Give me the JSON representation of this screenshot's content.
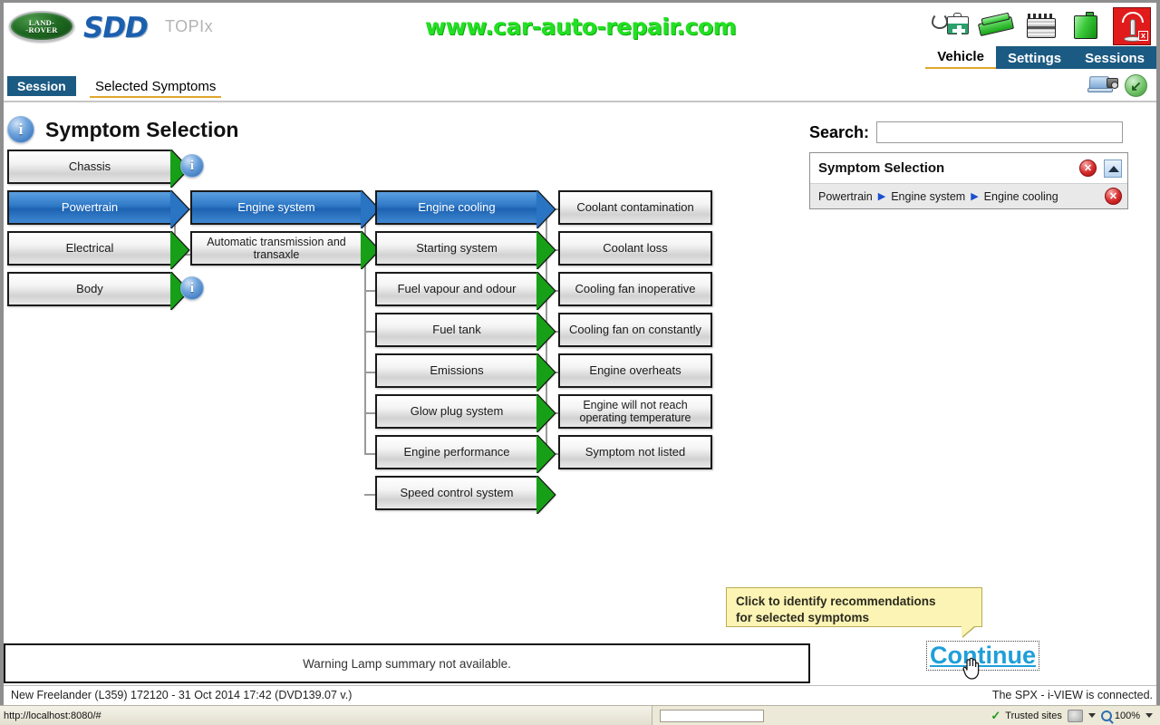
{
  "header": {
    "logo_line1": "LAND-",
    "logo_line2": "-ROVER",
    "product": "SDD",
    "topix": "TOPIx",
    "promo_url": "www.car-auto-repair.com",
    "icons": [
      {
        "name": "medical-kit-icon",
        "label": "Vehicle health"
      },
      {
        "name": "cable-icon",
        "label": "Connector"
      },
      {
        "name": "battery-icon",
        "label": "Battery"
      },
      {
        "name": "fluid-container-icon",
        "label": "Fluids"
      },
      {
        "name": "antenna-disconnected-icon",
        "label": "Network"
      }
    ],
    "nav_tabs": [
      {
        "label": "Vehicle",
        "active": true
      },
      {
        "label": "Settings",
        "active": false
      },
      {
        "label": "Sessions",
        "active": false
      }
    ]
  },
  "subbar": {
    "session_tab": "Session",
    "selected_symptoms_tab": "Selected Symptoms",
    "screenshot_icon": "screenshot-icon",
    "back_icon": "back-icon"
  },
  "page": {
    "title": "Symptom Selection"
  },
  "tree": {
    "column1": [
      {
        "label": "Chassis",
        "selected": false,
        "info": true
      },
      {
        "label": "Powertrain",
        "selected": true,
        "info": false
      },
      {
        "label": "Electrical",
        "selected": false,
        "info": false
      },
      {
        "label": "Body",
        "selected": false,
        "info": true
      }
    ],
    "column2": [
      {
        "label": "Engine system",
        "selected": true
      },
      {
        "label": "Automatic transmission and transaxle",
        "selected": false
      }
    ],
    "column3": [
      {
        "label": "Engine cooling",
        "selected": true
      },
      {
        "label": "Starting system",
        "selected": false
      },
      {
        "label": "Fuel vapour and odour",
        "selected": false
      },
      {
        "label": "Fuel tank",
        "selected": false
      },
      {
        "label": "Emissions",
        "selected": false
      },
      {
        "label": "Glow plug system",
        "selected": false
      },
      {
        "label": "Engine performance",
        "selected": false
      },
      {
        "label": "Speed control system",
        "selected": false
      }
    ],
    "column4": [
      {
        "label": "Coolant contamination"
      },
      {
        "label": "Coolant loss"
      },
      {
        "label": "Cooling fan inoperative"
      },
      {
        "label": "Cooling fan on constantly"
      },
      {
        "label": "Engine overheats"
      },
      {
        "label": "Engine will not reach operating temperature"
      },
      {
        "label": "Symptom not listed"
      }
    ]
  },
  "search": {
    "label": "Search:",
    "value": "",
    "placeholder": ""
  },
  "selection_panel": {
    "title": "Symptom Selection",
    "close_icon": "close-icon",
    "collapse_icon": "collapse-icon",
    "breadcrumb": [
      "Powertrain",
      "Engine system",
      "Engine cooling"
    ],
    "separator": "▶",
    "row_remove_icon": "remove-icon"
  },
  "tooltip": {
    "line1": "Click to identify recommendations",
    "line2": "for selected symptoms"
  },
  "footer": {
    "warning_text": "Warning Lamp summary not available.",
    "continue_label": "Continue",
    "vehicle_info": "New Freelander (L359) 172120 - 31 Oct 2014 17:42 (DVD139.07 v.)",
    "spx_status": "The SPX - i-VIEW is connected."
  },
  "statusbar": {
    "url": "http://localhost:8080/#",
    "zone": "Trusted sites",
    "zoom": "100%"
  },
  "colors": {
    "brand_blue": "#1b5a82",
    "selected_node": "#2f78c6",
    "arrow_green": "#17a017",
    "accent_gold": "#e0a72c",
    "promo_green": "#22e022",
    "continue_blue": "#1f9fd8",
    "tooltip_yellow": "#fbf4b4",
    "status_bg": "#ece9d8"
  }
}
